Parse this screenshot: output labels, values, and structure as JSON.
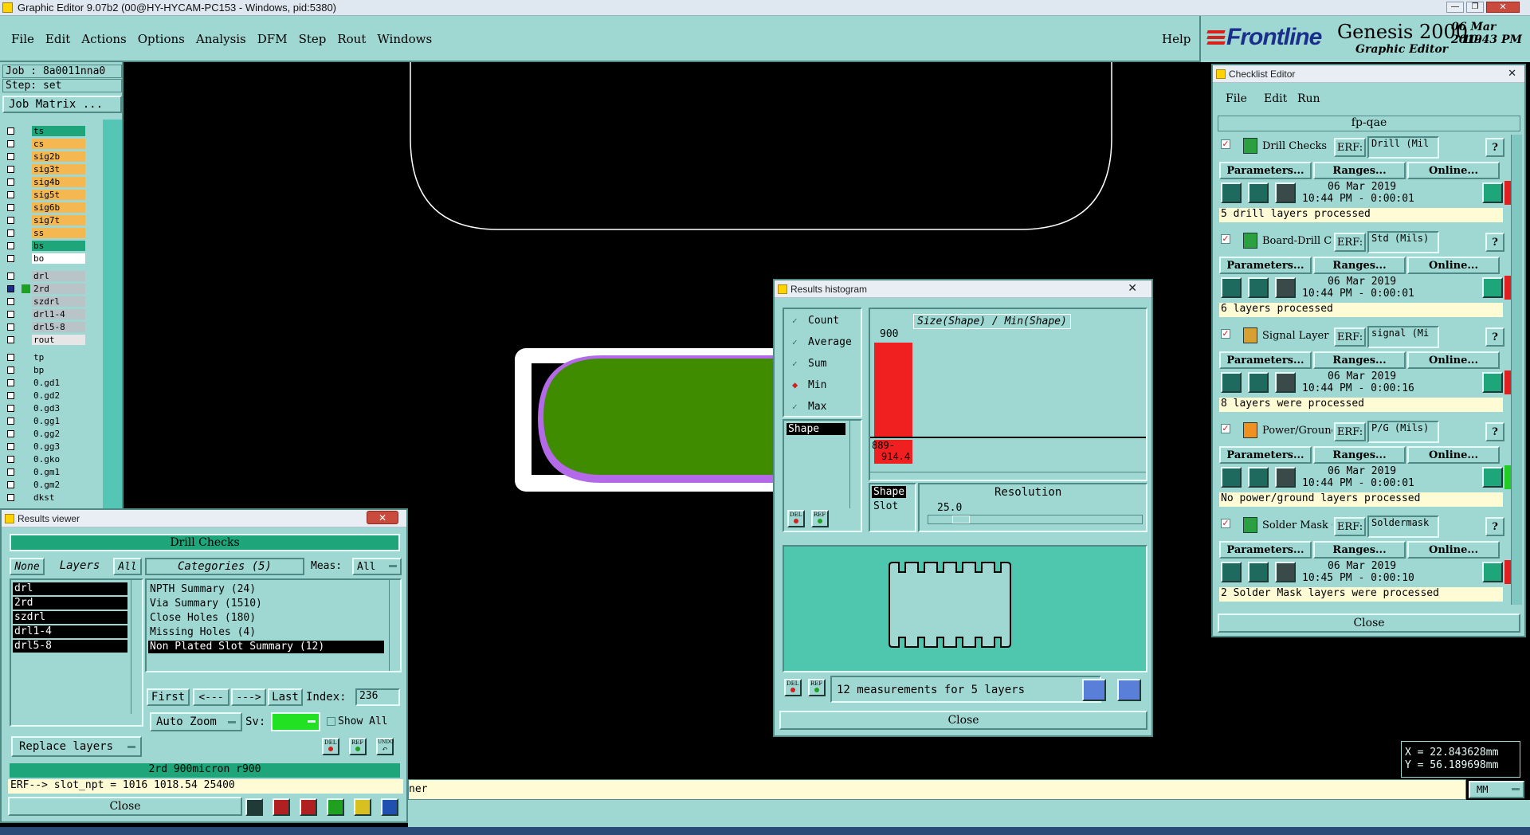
{
  "window": {
    "title": "Graphic Editor 9.07b2 (00@HY-HYCAM-PC153 - Windows, pid:5380)"
  },
  "menu": {
    "items": [
      "File",
      "Edit",
      "Actions",
      "Options",
      "Analysis",
      "DFM",
      "Step",
      "Rout",
      "Windows"
    ],
    "help": "Help"
  },
  "brand": {
    "logo": "Frontline",
    "product": "Genesis 2000",
    "subtitle": "Graphic Editor",
    "date": "06 Mar 2019",
    "time": "10:43 PM"
  },
  "job": {
    "job": "Job : 8a0011nna0",
    "step": "Step: set",
    "matrix_button": "Job Matrix ..."
  },
  "layers": [
    {
      "name": "ts",
      "color": "#1fa57a"
    },
    {
      "name": "cs",
      "color": "#f5b750"
    },
    {
      "name": "sig2b",
      "color": "#f5b750"
    },
    {
      "name": "sig3t",
      "color": "#f5b750"
    },
    {
      "name": "sig4b",
      "color": "#f5b750"
    },
    {
      "name": "sig5t",
      "color": "#f5b750"
    },
    {
      "name": "sig6b",
      "color": "#f5b750"
    },
    {
      "name": "sig7t",
      "color": "#f5b750"
    },
    {
      "name": "ss",
      "color": "#f5b750"
    },
    {
      "name": "bs",
      "color": "#1fa57a"
    },
    {
      "name": "bo",
      "color": "#ffffff"
    },
    {
      "name": "drl",
      "color": "#b9c4c9"
    },
    {
      "name": "2rd",
      "color": "#b9c4c9"
    },
    {
      "name": "szdrl",
      "color": "#b9c4c9"
    },
    {
      "name": "drl1-4",
      "color": "#b9c4c9"
    },
    {
      "name": "drl5-8",
      "color": "#b9c4c9"
    },
    {
      "name": "rout",
      "color": "#e6e6e6"
    },
    {
      "name": "tp",
      "color": "#9fd8d3"
    },
    {
      "name": "bp",
      "color": "#9fd8d3"
    },
    {
      "name": "0.gd1",
      "color": "#9fd8d3"
    },
    {
      "name": "0.gd2",
      "color": "#9fd8d3"
    },
    {
      "name": "0.gd3",
      "color": "#9fd8d3"
    },
    {
      "name": "0.gg1",
      "color": "#9fd8d3"
    },
    {
      "name": "0.gg2",
      "color": "#9fd8d3"
    },
    {
      "name": "0.gg3",
      "color": "#9fd8d3"
    },
    {
      "name": "0.gko",
      "color": "#9fd8d3"
    },
    {
      "name": "0.gm1",
      "color": "#9fd8d3"
    },
    {
      "name": "0.gm2",
      "color": "#9fd8d3"
    },
    {
      "name": "dkst",
      "color": "#9fd8d3"
    }
  ],
  "results_viewer": {
    "title": "Results viewer",
    "header": "Drill Checks",
    "none": "None",
    "layers_label": "Layers",
    "all": "All",
    "categories_label": "Categories (5)",
    "meas_label": "Meas:",
    "meas_value": "All",
    "layer_list": [
      "drl",
      "2rd",
      "szdrl",
      "drl1-4",
      "drl5-8"
    ],
    "categories": [
      "NPTH Summary (24)",
      "Via Summary (1510)",
      "Close Holes (180)",
      "Missing Holes (4)",
      "Non Plated Slot Summary (12)"
    ],
    "first": "First",
    "prev": "<---",
    "next": "--->",
    "last": "Last",
    "index_label": "Index:",
    "index_value": "236",
    "auto_zoom": "Auto Zoom",
    "sv": "Sv:",
    "show_all": "Show All",
    "replace_layers": "Replace layers",
    "del": "DEL",
    "ref": "REF",
    "undo": "UNDO",
    "status": "2rd 900micron  r900",
    "erf": "ERF--> slot_npt = 1016 1018.54 25400",
    "close": "Close"
  },
  "histogram": {
    "title": "Results histogram",
    "options": [
      "Count",
      "Average",
      "Sum",
      "Min",
      "Max"
    ],
    "selected": "Min",
    "list_item": "Shape",
    "chart_title": "Size(Shape) / Min(Shape)",
    "bar_value": "900",
    "bar_label_1": "889-",
    "bar_label_2": "914.4",
    "shape_items": [
      "Shape",
      "Slot"
    ],
    "resolution_label": "Resolution",
    "resolution_value": "25.0",
    "measurements": "12 measurements for 5 layers",
    "del": "DEL",
    "ref": "REF",
    "close": "Close",
    "chart_data": {
      "type": "bar",
      "categories": [
        "889-914.4"
      ],
      "values": [
        900
      ],
      "title": "Size(Shape) / Min(Shape)"
    }
  },
  "checklist": {
    "title": "Checklist Editor",
    "menu": [
      "File",
      "Edit",
      "Run"
    ],
    "name": "fp-qae",
    "checks": [
      {
        "name": "Drill Checks",
        "erf": "Drill (Mil",
        "date": "06 Mar 2019",
        "time": "10:44 PM - 0:00:01",
        "msg": "5 drill layers processed",
        "status": "#e02020"
      },
      {
        "name": "Board-Drill Che",
        "erf": "Std (Mils)",
        "date": "06 Mar 2019",
        "time": "10:44 PM - 0:00:01",
        "msg": "6 layers processed",
        "status": "#e02020"
      },
      {
        "name": "Signal Layer Ch",
        "erf": "signal (Mi",
        "date": "06 Mar 2019",
        "time": "10:44 PM - 0:00:16",
        "msg": "8 layers were processed",
        "status": "#e02020"
      },
      {
        "name": "Power/Ground C",
        "erf": "P/G (Mils)",
        "date": "06 Mar 2019",
        "time": "10:44 PM - 0:00:01",
        "msg": "No power/ground layers processed",
        "status": "#22cc22"
      },
      {
        "name": "Solder Mask Ch",
        "erf": "Soldermask",
        "date": "06 Mar 2019",
        "time": "10:45 PM - 0:00:10",
        "msg": "2 Solder Mask layers were processed",
        "status": "#e02020"
      }
    ],
    "erf_label": "ERF:",
    "params": "Parameters...",
    "ranges": "Ranges...",
    "online": "Online...",
    "help": "?",
    "close": "Close"
  },
  "coords": {
    "x": "X = 22.843628mm",
    "y": "Y = 56.189698mm",
    "unit": "MM"
  },
  "bottom_status": "ner"
}
